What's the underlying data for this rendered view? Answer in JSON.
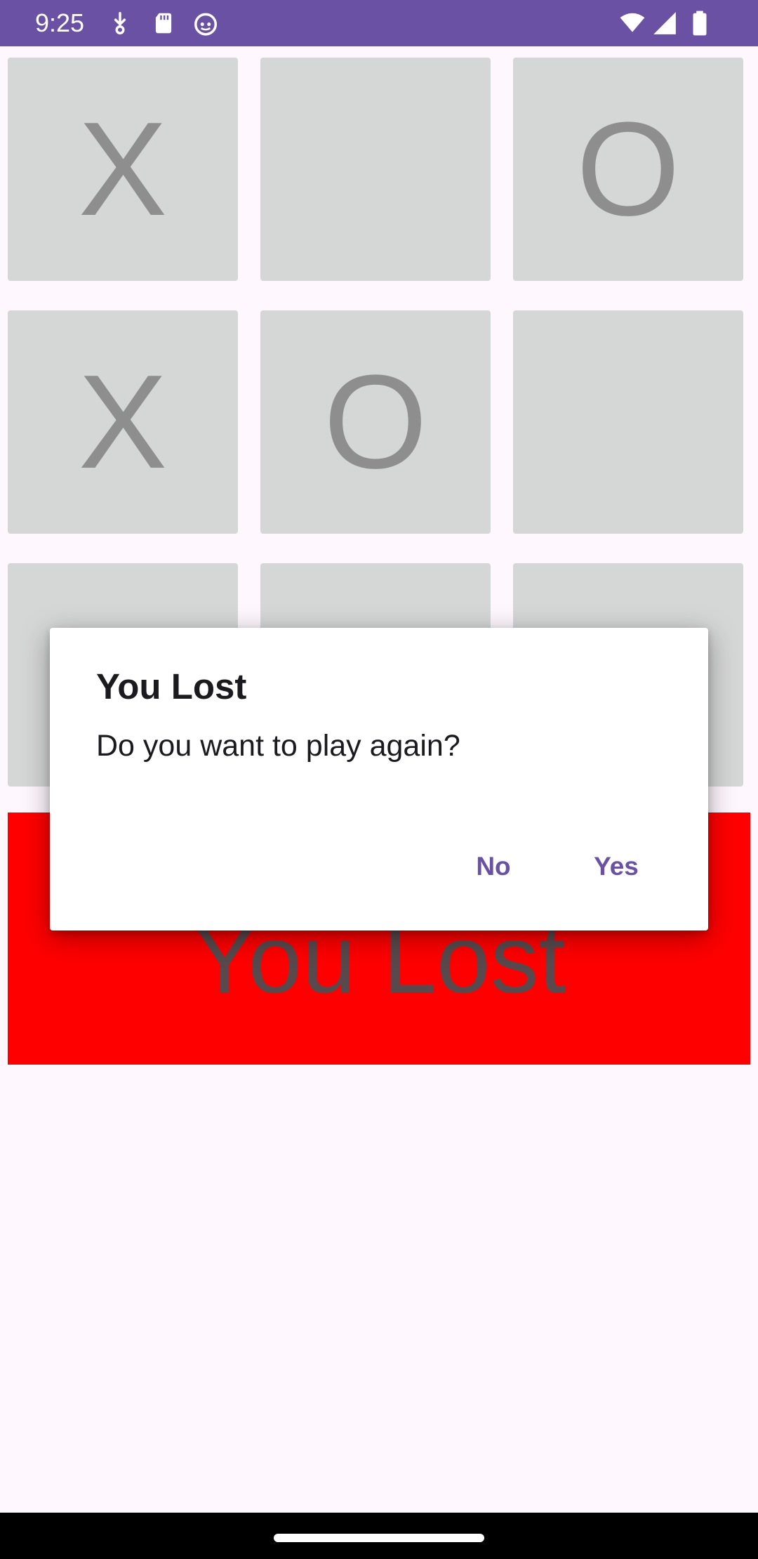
{
  "status_bar": {
    "time": "9:25",
    "left_icons": [
      "download-icon",
      "sd-card-icon",
      "android-debug-icon"
    ],
    "right_icons": [
      "wifi-icon",
      "signal-icon",
      "battery-icon"
    ]
  },
  "board": {
    "cells": [
      "X",
      "",
      "O",
      "X",
      "O",
      "",
      "",
      "",
      ""
    ]
  },
  "result_banner": {
    "text": "You Lost",
    "background": "#FF0000"
  },
  "dialog": {
    "title": "You Lost",
    "message": "Do you want to play again?",
    "negative_label": "No",
    "positive_label": "Yes"
  },
  "colors": {
    "status_bar": "#6A51A3",
    "accent": "#6A51A3",
    "cell_background": "#D5D6D6",
    "cell_text": "#8E8E8E",
    "page_background": "#FEF7FD"
  }
}
